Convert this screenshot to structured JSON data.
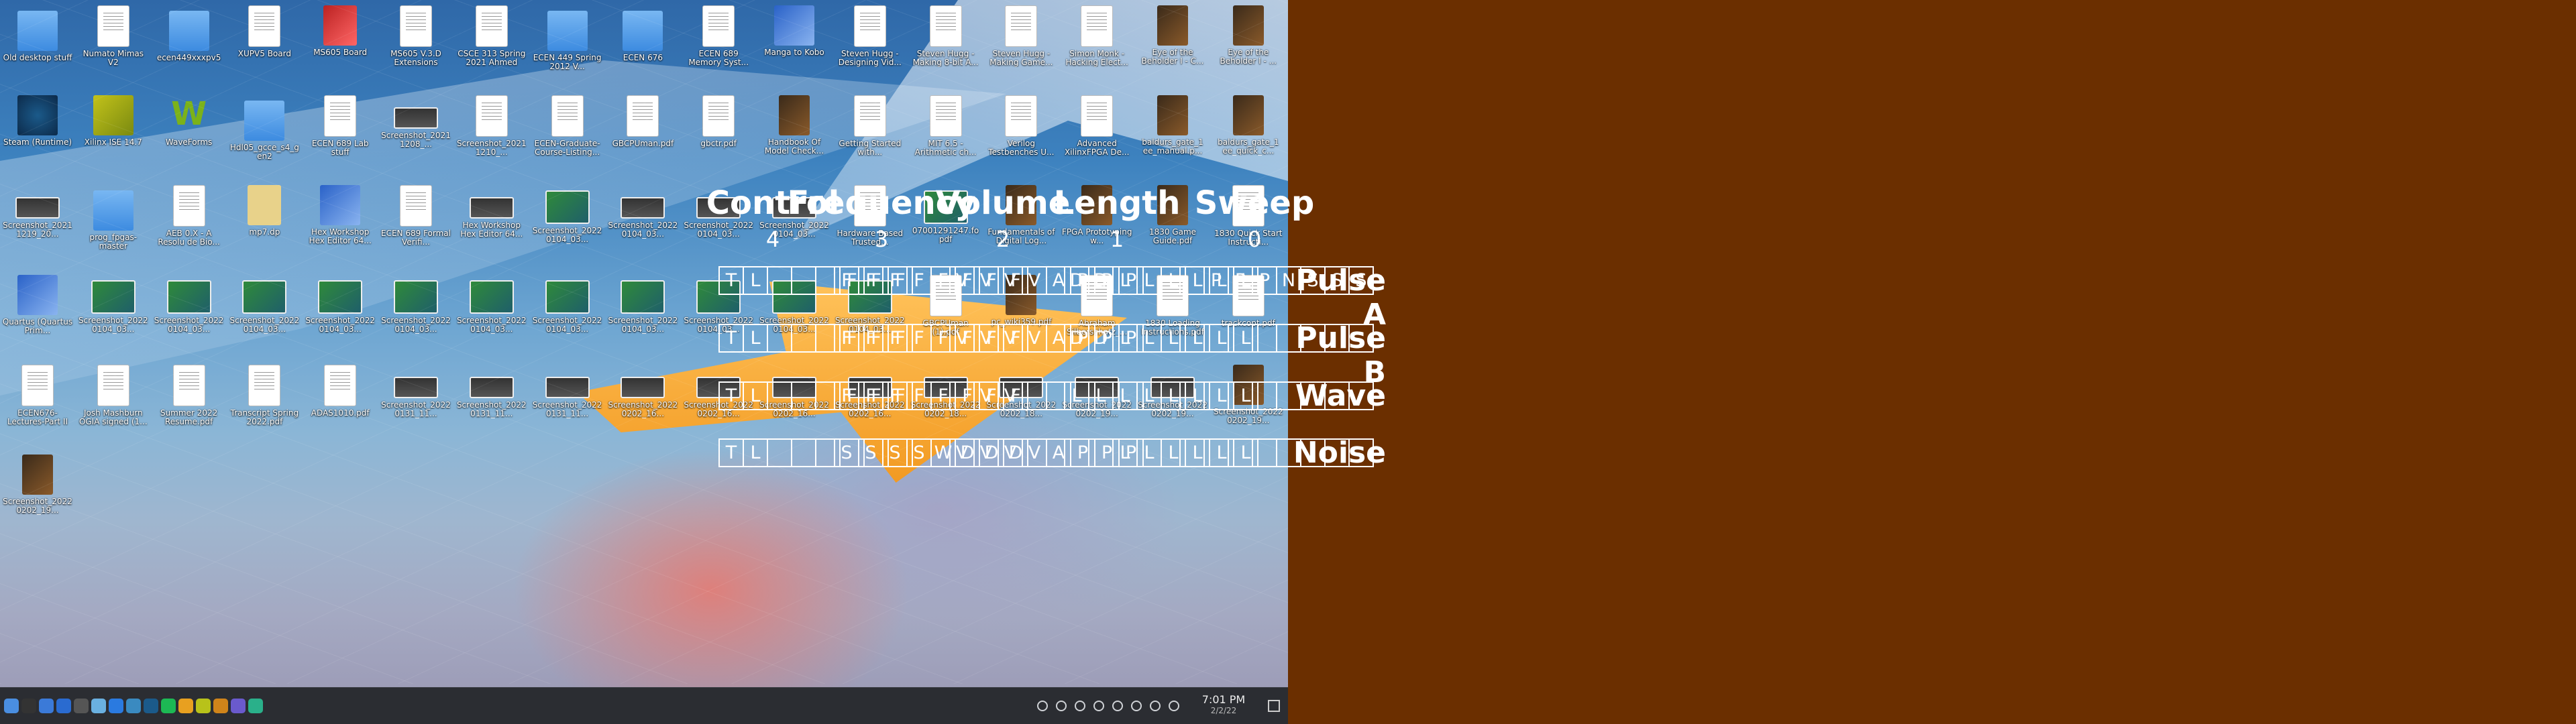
{
  "desktop": {
    "icons": [
      {
        "label": "Old desktop stuff",
        "kind": "folder"
      },
      {
        "label": "Numato Mimas V2",
        "kind": "doc"
      },
      {
        "label": "ecen449xxxpv5",
        "kind": "folder"
      },
      {
        "label": "XUPV5 Board",
        "kind": "doc"
      },
      {
        "label": "MS605 Board",
        "kind": "red"
      },
      {
        "label": "MS605 V.3.D Extensions",
        "kind": "doc"
      },
      {
        "label": "CSCE 313 Spring 2021 Ahmed",
        "kind": "doc"
      },
      {
        "label": "ECEN 449 Spring 2012 V...",
        "kind": "folder"
      },
      {
        "label": "ECEN 676",
        "kind": "folder"
      },
      {
        "label": "ECEN 689 Memory Syst...",
        "kind": "doc"
      },
      {
        "label": "Manga to Kobo",
        "kind": "blue"
      },
      {
        "label": "Steven Hugg - Designing Vid...",
        "kind": "doc"
      },
      {
        "label": "Steven Hugg - Making 8-bit A...",
        "kind": "doc"
      },
      {
        "label": "Steven Hugg - Making Game...",
        "kind": "doc"
      },
      {
        "label": "Simon Monk - Hacking Elect...",
        "kind": "doc"
      },
      {
        "label": "Eye of the Beholder I - C...",
        "kind": "book"
      },
      {
        "label": "Eye of the Beholder I - ...",
        "kind": "book"
      },
      {
        "label": "Steam (Runtime)",
        "kind": "steam"
      },
      {
        "label": "Xilinx ISE 14.7",
        "kind": "yellow"
      },
      {
        "label": "WaveForms",
        "kind": "wf"
      },
      {
        "label": "Hdl05_gcce_s4_gen2",
        "kind": "folder"
      },
      {
        "label": "ECEN 689 Lab stuff",
        "kind": "doc"
      },
      {
        "label": "Screenshot_20211208_...",
        "kind": "shot"
      },
      {
        "label": "Screenshot_20211210_...",
        "kind": "doc"
      },
      {
        "label": "ECEN-Graduate-Course-Listing...",
        "kind": "doc"
      },
      {
        "label": "GBCPUman.pdf",
        "kind": "doc"
      },
      {
        "label": "gbctr.pdf",
        "kind": "doc"
      },
      {
        "label": "Handbook Of Model Check...",
        "kind": "book"
      },
      {
        "label": "Getting Started with...",
        "kind": "doc"
      },
      {
        "label": "MIT 6.5 - Arithmetic ch...",
        "kind": "doc"
      },
      {
        "label": "Verilog Testbenches U...",
        "kind": "doc"
      },
      {
        "label": "Advanced XilinxFPGA De...",
        "kind": "doc"
      },
      {
        "label": "baldurs_gate_1 ee_manual.p...",
        "kind": "book"
      },
      {
        "label": "baldurs_gate_1 ee_quick_c...",
        "kind": "book"
      },
      {
        "label": "Screenshot_20211219_20...",
        "kind": "shot"
      },
      {
        "label": "prog_fpgas-master",
        "kind": "folder"
      },
      {
        "label": "AEB 0.X - A Resolu de Bio...",
        "kind": "doc"
      },
      {
        "label": "mp7.dp",
        "kind": "tan"
      },
      {
        "label": "Hex Workshop Hex Editor 64...",
        "kind": "blue"
      },
      {
        "label": "ECEN 689 Formal Verifi...",
        "kind": "doc"
      },
      {
        "label": "Hex Workshop Hex Editor 64...",
        "kind": "shot"
      },
      {
        "label": "Screenshot_20220104_03...",
        "kind": "img"
      },
      {
        "label": "Screenshot_20220104_03...",
        "kind": "shot"
      },
      {
        "label": "Screenshot_20220104_03...",
        "kind": "shot"
      },
      {
        "label": "Screenshot_20220104_03...",
        "kind": "shot"
      },
      {
        "label": "Hardware Based Trusted...",
        "kind": "doc"
      },
      {
        "label": "07001291247.fo pdf",
        "kind": "img"
      },
      {
        "label": "Fundamentals of Digital Log...",
        "kind": "book"
      },
      {
        "label": "FPGA Prototyping w...",
        "kind": "book"
      },
      {
        "label": "1830 Game Guide.pdf",
        "kind": "book"
      },
      {
        "label": "1830 Quick Start Instructi...",
        "kind": "doc"
      },
      {
        "label": "Quartus (Quartus Prim...",
        "kind": "blue"
      },
      {
        "label": "Screenshot_20220104_03...",
        "kind": "img"
      },
      {
        "label": "Screenshot_20220104_03...",
        "kind": "img"
      },
      {
        "label": "Screenshot_20220104_03...",
        "kind": "img"
      },
      {
        "label": "Screenshot_20220104_03...",
        "kind": "img"
      },
      {
        "label": "Screenshot_20220104_03...",
        "kind": "img"
      },
      {
        "label": "Screenshot_20220104_03...",
        "kind": "img"
      },
      {
        "label": "Screenshot_20220104_03...",
        "kind": "img"
      },
      {
        "label": "Screenshot_20220104_03...",
        "kind": "img"
      },
      {
        "label": "Screenshot_20220104_03...",
        "kind": "img"
      },
      {
        "label": "Screenshot_20220104_03...",
        "kind": "img"
      },
      {
        "label": "Screenshot_20220104_03...",
        "kind": "img"
      },
      {
        "label": "GBCPUman (1).pdf",
        "kind": "doc"
      },
      {
        "label": "pc_wiki359.pdf",
        "kind": "book"
      },
      {
        "label": "Abraham Silberschatz_...",
        "kind": "doc"
      },
      {
        "label": "1830 Loading Instructions.pdf",
        "kind": "doc"
      },
      {
        "label": "trackcopt.pdf",
        "kind": "doc"
      },
      {
        "label": "ECEN676-Lectures-Part II",
        "kind": "doc"
      },
      {
        "label": "Josh Mashburn OGIA signed (1...",
        "kind": "doc"
      },
      {
        "label": "Summer 2022 Resume.pdf",
        "kind": "doc"
      },
      {
        "label": "Transcript Spring 2022.pdf",
        "kind": "doc"
      },
      {
        "label": "ADAS1010.pdf",
        "kind": "doc"
      },
      {
        "label": "Screenshot_20220131_11...",
        "kind": "shot"
      },
      {
        "label": "Screenshot_20220131_11...",
        "kind": "shot"
      },
      {
        "label": "Screenshot_20220131_11...",
        "kind": "shot"
      },
      {
        "label": "Screenshot_20220202_16...",
        "kind": "shot"
      },
      {
        "label": "Screenshot_20220202_16...",
        "kind": "shot"
      },
      {
        "label": "Screenshot_20220202_16...",
        "kind": "shot"
      },
      {
        "label": "Screenshot_20220202_16...",
        "kind": "shot"
      },
      {
        "label": "Screenshot_20220202_18...",
        "kind": "shot"
      },
      {
        "label": "Screenshot_20220202_18...",
        "kind": "shot"
      },
      {
        "label": "Screenshot_20220202_19...",
        "kind": "shot"
      },
      {
        "label": "Screenshot_20220202_19...",
        "kind": "shot"
      },
      {
        "label": "Screenshot_20220202_19...",
        "kind": "book"
      },
      {
        "label": "Screenshot_20220202_19...",
        "kind": "book"
      }
    ],
    "taskbar": {
      "apps": [
        "kde-menu-icon",
        "terminal-icon",
        "dolphin-icon",
        "files-icon",
        "console-icon",
        "nextcloud-icon",
        "dropbox-icon",
        "kde-connect-icon",
        "steam-icon",
        "spotify-icon",
        "chrome-icon",
        "xilinx-icon",
        "vivado-icon",
        "teams-icon",
        "pycharm-icon"
      ],
      "clock_time": "7:01 PM",
      "clock_date": "2/2/22"
    }
  },
  "panel": {
    "columns": [
      {
        "title": "Control",
        "num": "4"
      },
      {
        "title": "Frequency",
        "num": "3"
      },
      {
        "title": "Volume",
        "num": "2"
      },
      {
        "title": "Length",
        "num": "1"
      },
      {
        "title": "Sweep",
        "num": "0"
      }
    ],
    "rows": [
      {
        "label": "Pulse A",
        "regs": [
          [
            "T",
            "L",
            "",
            "",
            "",
            "F",
            "F",
            "F"
          ],
          [
            "F",
            "F",
            "F",
            "F",
            "F",
            "F",
            "F",
            "F"
          ],
          [
            "V",
            "V",
            "V",
            "V",
            "A",
            "P",
            "P",
            "P"
          ],
          [
            "D",
            "D",
            "L",
            "L",
            "L",
            "L",
            "L",
            "L"
          ],
          [
            "",
            "P",
            "P",
            "P",
            "N",
            "S",
            "S",
            "S"
          ]
        ]
      },
      {
        "label": "Pulse B",
        "regs": [
          [
            "T",
            "L",
            "",
            "",
            "",
            "F",
            "F",
            "F"
          ],
          [
            "F",
            "F",
            "F",
            "F",
            "F",
            "F",
            "F",
            "F"
          ],
          [
            "V",
            "V",
            "V",
            "V",
            "A",
            "P",
            "P",
            "P"
          ],
          [
            "D",
            "D",
            "L",
            "L",
            "L",
            "L",
            "L",
            "L"
          ],
          [
            "",
            "",
            "",
            "",
            "",
            "",
            "",
            ""
          ]
        ]
      },
      {
        "label": "Wave",
        "regs": [
          [
            "T",
            "L",
            "",
            "",
            "",
            "F",
            "F",
            "F"
          ],
          [
            "F",
            "F",
            "F",
            "F",
            "F",
            "F",
            "F",
            "F"
          ],
          [
            "",
            "V",
            "V",
            "",
            "",
            "",
            "",
            ""
          ],
          [
            "L",
            "L",
            "L",
            "L",
            "L",
            "L",
            "L",
            "L"
          ],
          [
            "",
            "",
            "",
            "",
            "",
            "",
            "",
            ""
          ]
        ]
      },
      {
        "label": "Noise",
        "regs": [
          [
            "T",
            "L",
            "",
            "",
            "",
            "",
            "",
            ""
          ],
          [
            "S",
            "S",
            "S",
            "S",
            "W",
            "D",
            "D",
            "D"
          ],
          [
            "V",
            "V",
            "V",
            "V",
            "A",
            "P",
            "P",
            "P"
          ],
          [
            "",
            "",
            "L",
            "L",
            "L",
            "L",
            "L",
            "L"
          ],
          [
            "",
            "",
            "",
            "",
            "",
            "",
            "",
            ""
          ]
        ]
      }
    ]
  }
}
